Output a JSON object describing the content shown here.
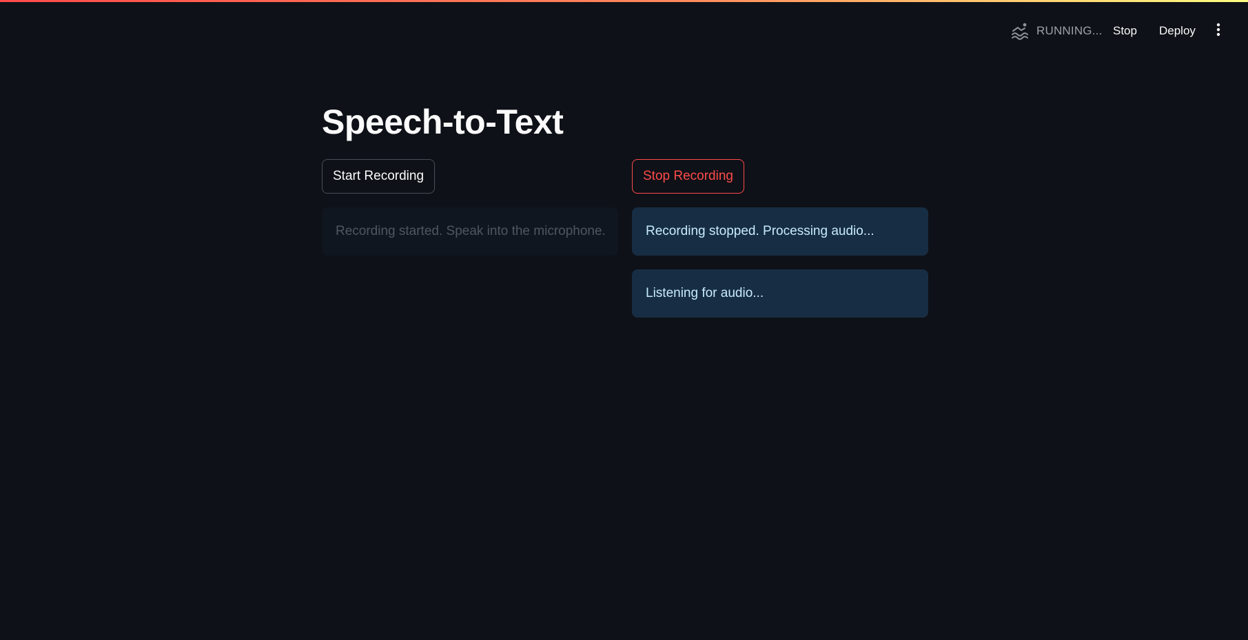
{
  "header": {
    "status_icon": "swimmer-icon",
    "status_text": "RUNNING...",
    "stop_label": "Stop",
    "deploy_label": "Deploy",
    "menu_icon": "vertical-ellipsis-icon"
  },
  "main": {
    "title": "Speech-to-Text",
    "left_column": {
      "button_label": "Start Recording",
      "messages": [
        "Recording started. Speak into the microphone."
      ]
    },
    "right_column": {
      "button_label": "Stop Recording",
      "messages": [
        "Recording stopped. Processing audio...",
        "Listening for audio..."
      ]
    }
  },
  "colors": {
    "background": "#0e1117",
    "accent_red": "#ff4b4b",
    "info_background": "#172d43",
    "info_text": "#c7ebff",
    "stale_text": "#4f5662"
  }
}
